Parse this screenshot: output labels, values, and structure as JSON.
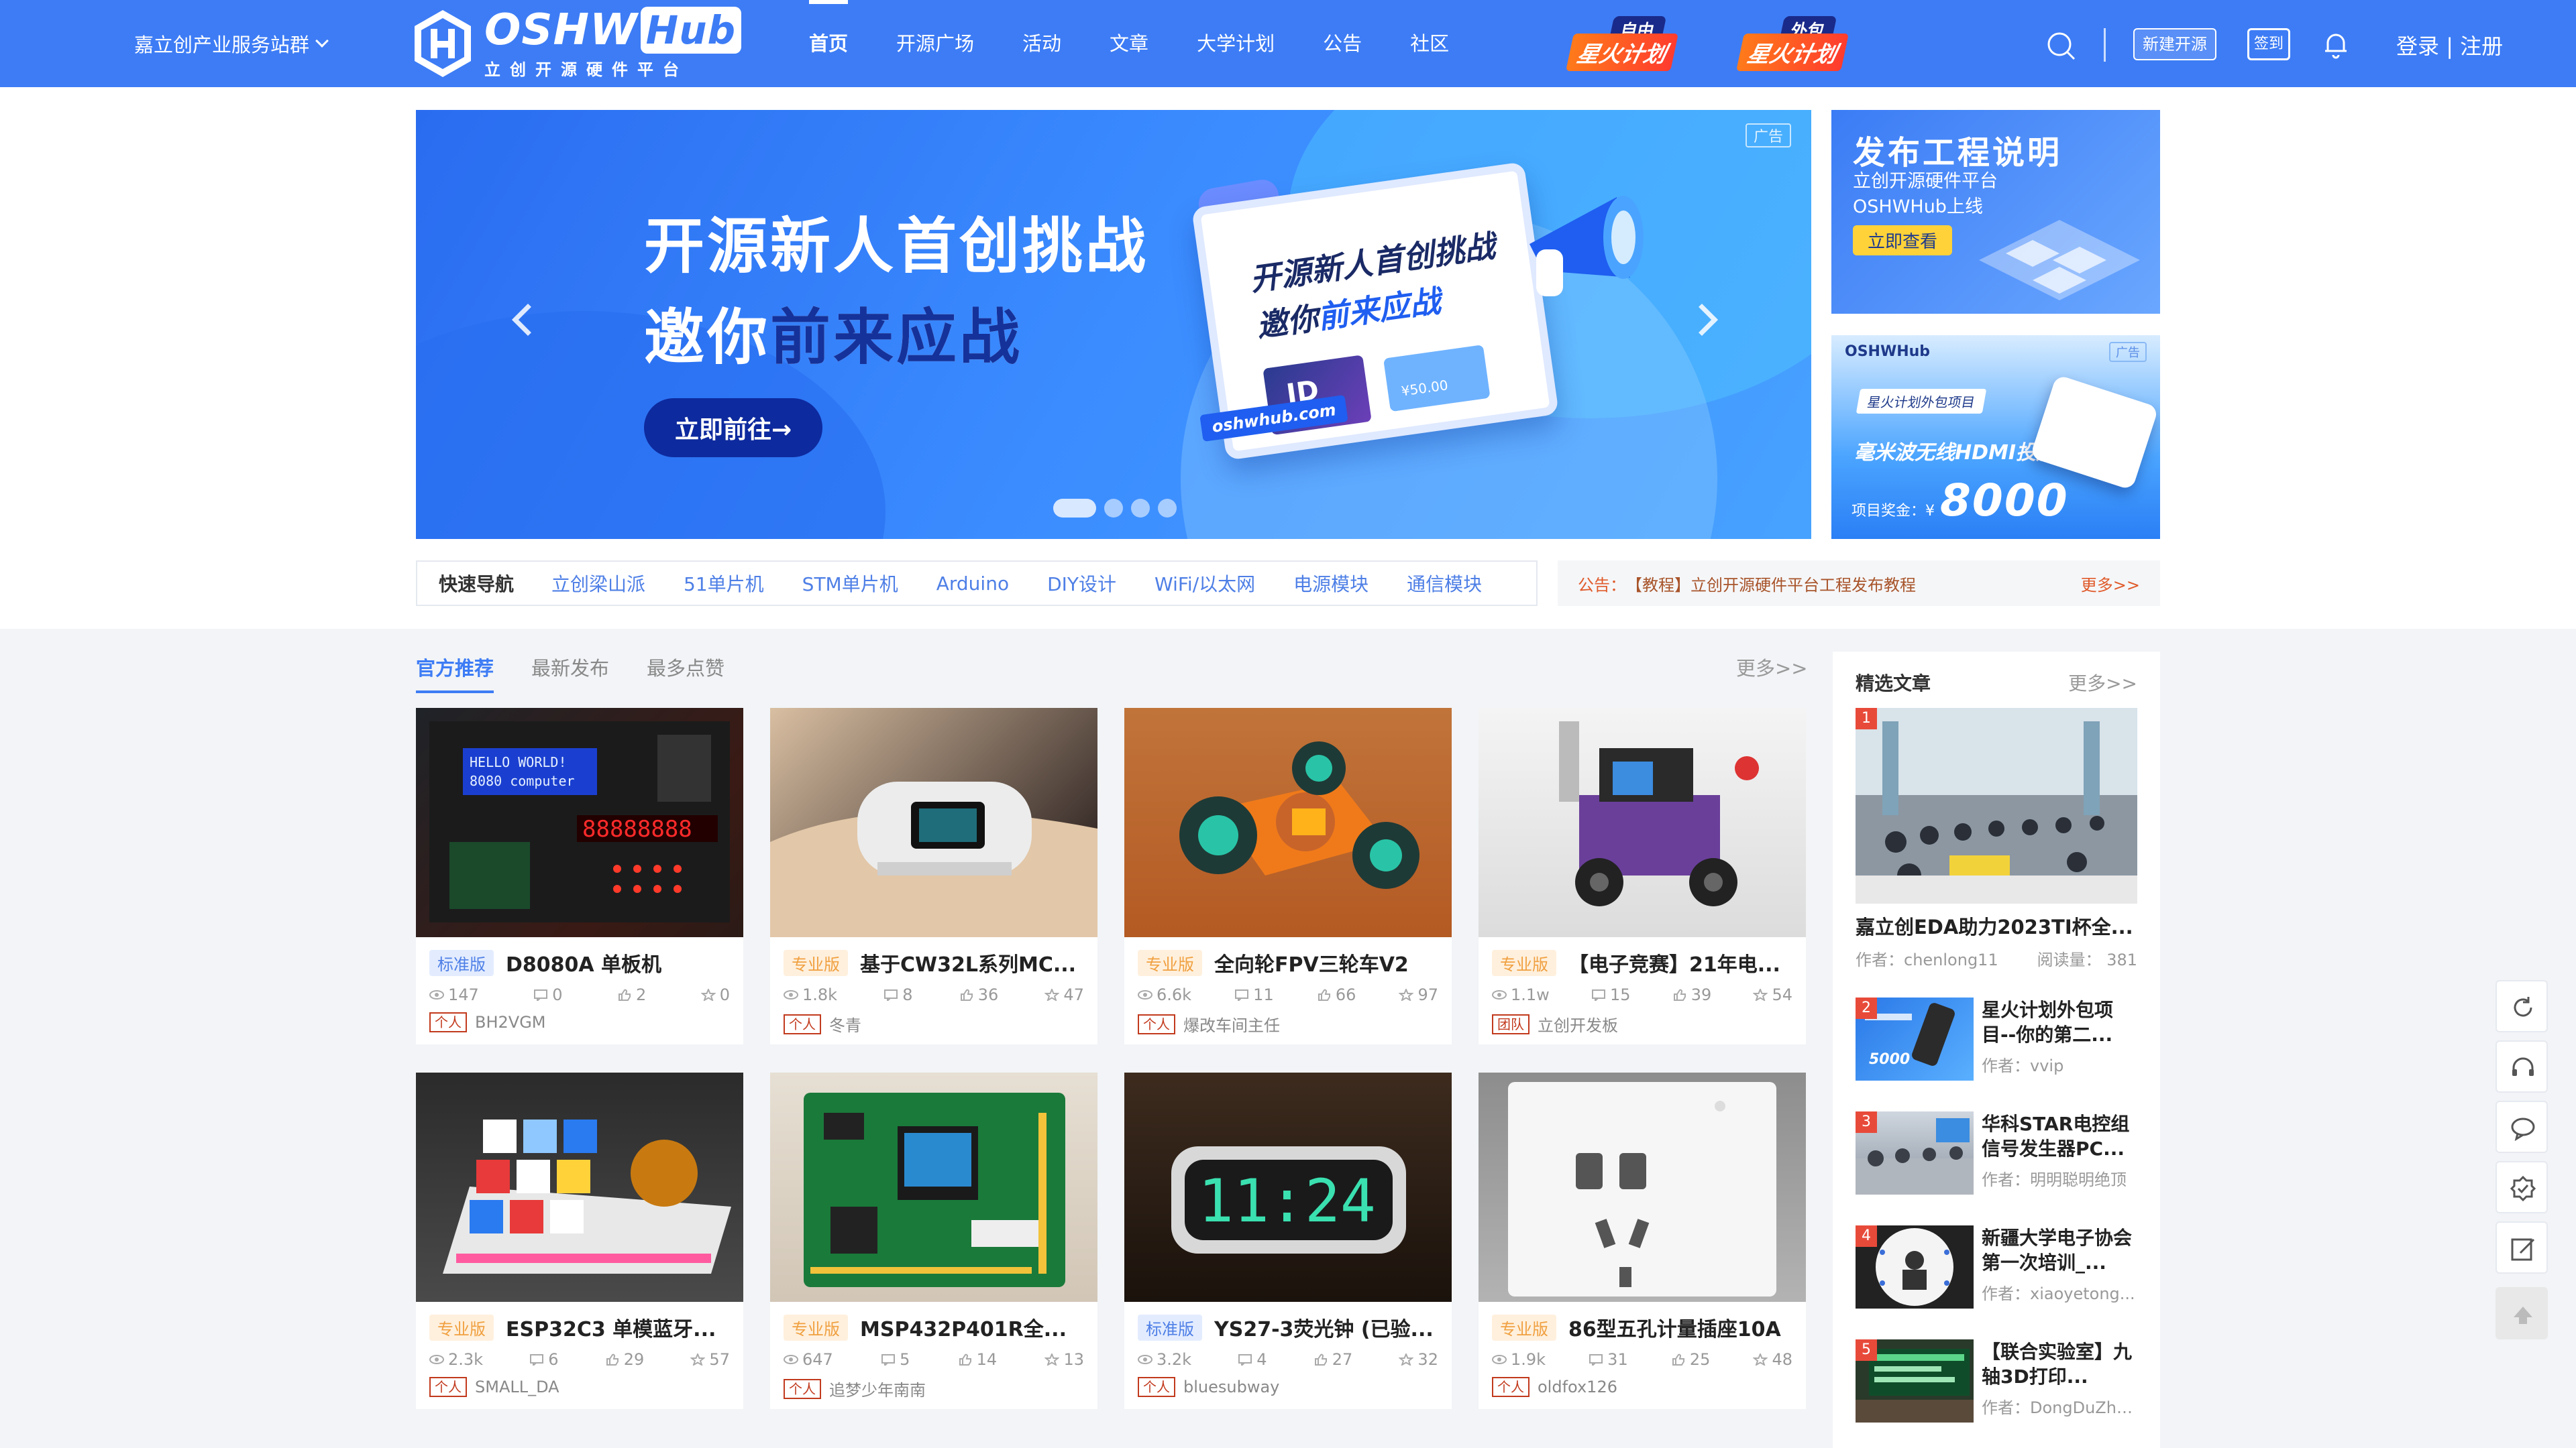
{
  "header": {
    "station": "嘉立创产业服务站群",
    "logo_main": "OSHW",
    "logo_hub": "Hub",
    "logo_sub": "立创开源硬件平台",
    "nav": [
      "首页",
      "开源广场",
      "活动",
      "文章",
      "大学计划",
      "公告",
      "社区"
    ],
    "plan1_tag": "自由",
    "plan1_main": "星火计划",
    "plan2_tag": "外包",
    "plan2_main": "星火计划",
    "new_project": "新建开源",
    "sign_in": "签到",
    "login": "登录",
    "separator": "|",
    "register": "注册"
  },
  "banner": {
    "ad_label": "广告",
    "line1": "开源新人首创挑战",
    "line2_pre": "邀你",
    "line2_hl": "前来应战",
    "cta": "立即前往→",
    "screen_line1": "开源新人首创挑战",
    "screen_line2_pre": "邀你",
    "screen_line2_hl": "前来应战",
    "card_text": "ID",
    "coupon_text": "¥50.00",
    "url": "oshwhub.com"
  },
  "side_ad1": {
    "title": "发布工程说明",
    "line1": "立创开源硬件平台",
    "line2": "OSHWHub上线",
    "cta": "立即查看"
  },
  "side_ad2": {
    "logo": "OSHWHub",
    "ad_label": "广告",
    "tag": "星火计划外包项目",
    "title": "毫米波无线HDMI投屏器",
    "prize_label": "项目奖金：¥",
    "prize": "8000"
  },
  "quicknav": {
    "title": "快速导航",
    "items": [
      "立创梁山派",
      "51单片机",
      "STM单片机",
      "Arduino",
      "DIY设计",
      "WiFi/以太网",
      "电源模块",
      "通信模块"
    ]
  },
  "notice": {
    "label": "公告：",
    "text": "【教程】立创开源硬件平台工程发布教程",
    "more": "更多>>"
  },
  "tabs": [
    "官方推荐",
    "最新发布",
    "最多点赞"
  ],
  "tabs_more": "更多>>",
  "projects": [
    {
      "level": "标准版",
      "title": "D8080A 单板机",
      "views": "147",
      "comments": "0",
      "likes": "2",
      "stars": "0",
      "author_type": "个人",
      "author": "BH2VGM"
    },
    {
      "level": "专业版",
      "title": "基于CW32L系列MC...",
      "views": "1.8k",
      "comments": "8",
      "likes": "36",
      "stars": "47",
      "author_type": "个人",
      "author": "冬青"
    },
    {
      "level": "专业版",
      "title": "全向轮FPV三轮车V2",
      "views": "6.6k",
      "comments": "11",
      "likes": "66",
      "stars": "97",
      "author_type": "个人",
      "author": "爆改车间主任"
    },
    {
      "level": "专业版",
      "title": "【电子竞赛】21年电...",
      "views": "1.1w",
      "comments": "15",
      "likes": "39",
      "stars": "54",
      "author_type": "团队",
      "author": "立创开发板"
    },
    {
      "level": "专业版",
      "title": "ESP32C3 单模蓝牙...",
      "views": "2.3k",
      "comments": "6",
      "likes": "29",
      "stars": "57",
      "author_type": "个人",
      "author": "SMALL_DA"
    },
    {
      "level": "专业版",
      "title": "MSP432P401R全...",
      "views": "647",
      "comments": "5",
      "likes": "14",
      "stars": "13",
      "author_type": "个人",
      "author": "追梦少年南南"
    },
    {
      "level": "标准版",
      "title": "YS27-3荧光钟 (已验...",
      "views": "3.2k",
      "comments": "4",
      "likes": "27",
      "stars": "32",
      "author_type": "个人",
      "author": "bluesubway"
    },
    {
      "level": "专业版",
      "title": "86型五孔计量插座10A",
      "views": "1.9k",
      "comments": "31",
      "likes": "25",
      "stars": "48",
      "author_type": "个人",
      "author": "oldfox126"
    }
  ],
  "articles": {
    "title": "精选文章",
    "more": "更多>>",
    "top": {
      "rank": "1",
      "title": "嘉立创EDA助力2023TI杯全...",
      "author": "作者：chenlong11",
      "reads": "阅读量： 381"
    },
    "items": [
      {
        "rank": "2",
        "title": "星火计划外包项目--你的第二...",
        "author": "作者：vvip",
        "img_text": "5000"
      },
      {
        "rank": "3",
        "title": "华科STAR电控组信号发生器PC...",
        "author": "作者：明明聪明绝顶"
      },
      {
        "rank": "4",
        "title": "新疆大学电子协会第一次培训_...",
        "author": "作者：xiaoyetong..."
      },
      {
        "rank": "5",
        "title": "【联合实验室】九轴3D打印...",
        "author": "作者：DongDuZhi..."
      }
    ]
  },
  "thumb_texts": {
    "lcd1": "HELLO WORLD!",
    "lcd2": "8080 computer",
    "seg": "88888888",
    "clock": "11:24"
  }
}
